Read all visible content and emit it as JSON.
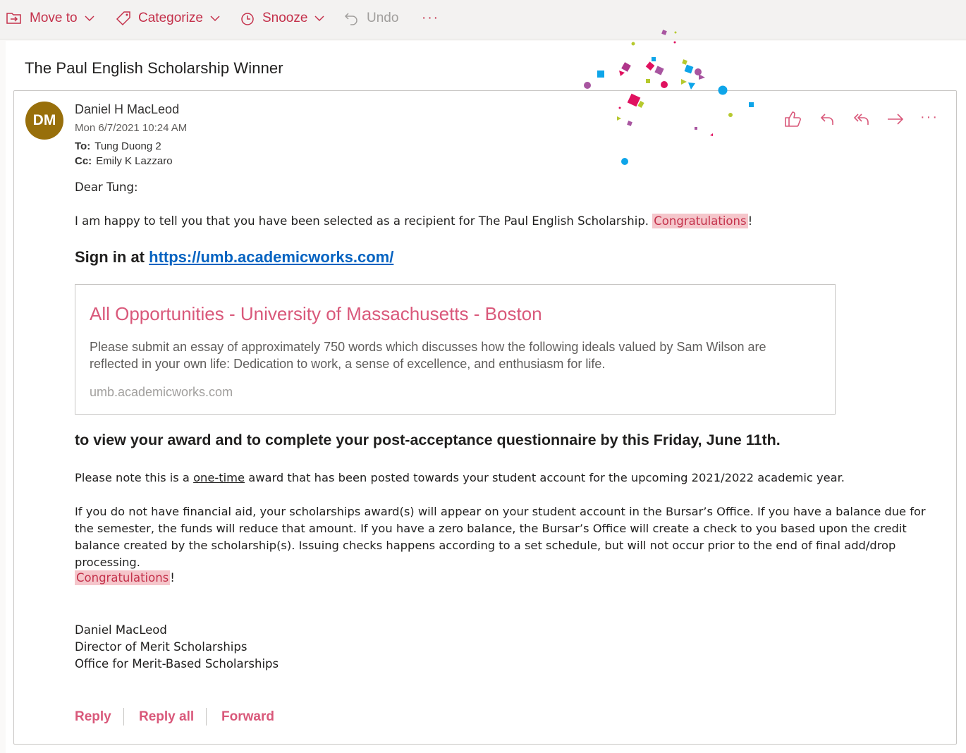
{
  "toolbar": {
    "move_to": "Move to",
    "categorize": "Categorize",
    "snooze": "Snooze",
    "undo": "Undo",
    "more": "···"
  },
  "message": {
    "subject": "The Paul English Scholarship Winner",
    "avatar_initials": "DM",
    "avatar_color": "#986f0b",
    "sender": "Daniel H MacLeod",
    "date": "Mon 6/7/2021 10:24 AM",
    "to_label": "To:",
    "to": "Tung Duong 2",
    "cc_label": "Cc:",
    "cc": "Emily K Lazzaro",
    "actions": [
      "like-icon",
      "reply-icon",
      "reply-all-icon",
      "forward-icon",
      "more-icon"
    ]
  },
  "body": {
    "greeting": "Dear Tung:",
    "line1_pre": "I am happy to tell you that you have been selected as a recipient for The Paul English Scholarship. ",
    "line1_hl": "Congratulations",
    "line1_post": "!",
    "signin_pre": "Sign in at ",
    "signin_link": "https://umb.academicworks.com/",
    "preview_title": "All Opportunities - University of Massachusetts - Boston",
    "preview_desc": "Please submit an essay of approximately 750 words which discusses how the following ideals valued by Sam Wilson are reflected in your own life: Dedication to work, a sense of excellence, and enthusiasm for life.",
    "preview_domain": "umb.academicworks.com",
    "bold_line": "to view your award and to complete your post-acceptance questionnaire by this Friday, June 11th.",
    "note_pre": "Please note this is a ",
    "note_u": "one-time",
    "note_post": " award that has been posted towards your student account for the upcoming 2021/2022 academic year.",
    "para": "If you do not have financial aid, your scholarships award(s) will appear on your student account in the Bursar’s Office.  If you have a balance due for the semester, the funds will reduce that amount.  If you have a zero balance, the Bursar’s Office will create a check to you based upon the credit balance created by the scholarship(s).  Issuing checks happens according to a set schedule, but will not occur prior to the end of final add/drop processing.",
    "congrats_hl": "Congratulations",
    "congrats_post": "!",
    "sig_name": "Daniel MacLeod",
    "sig_title": "Director of Merit Scholarships",
    "sig_office": "Office for Merit-Based Scholarships"
  },
  "footer": {
    "reply": "Reply",
    "reply_all": "Reply all",
    "forward": "Forward"
  },
  "colors": {
    "accent": "#c4314b",
    "link": "#0563c1",
    "highlight": "#f5c6cb"
  }
}
